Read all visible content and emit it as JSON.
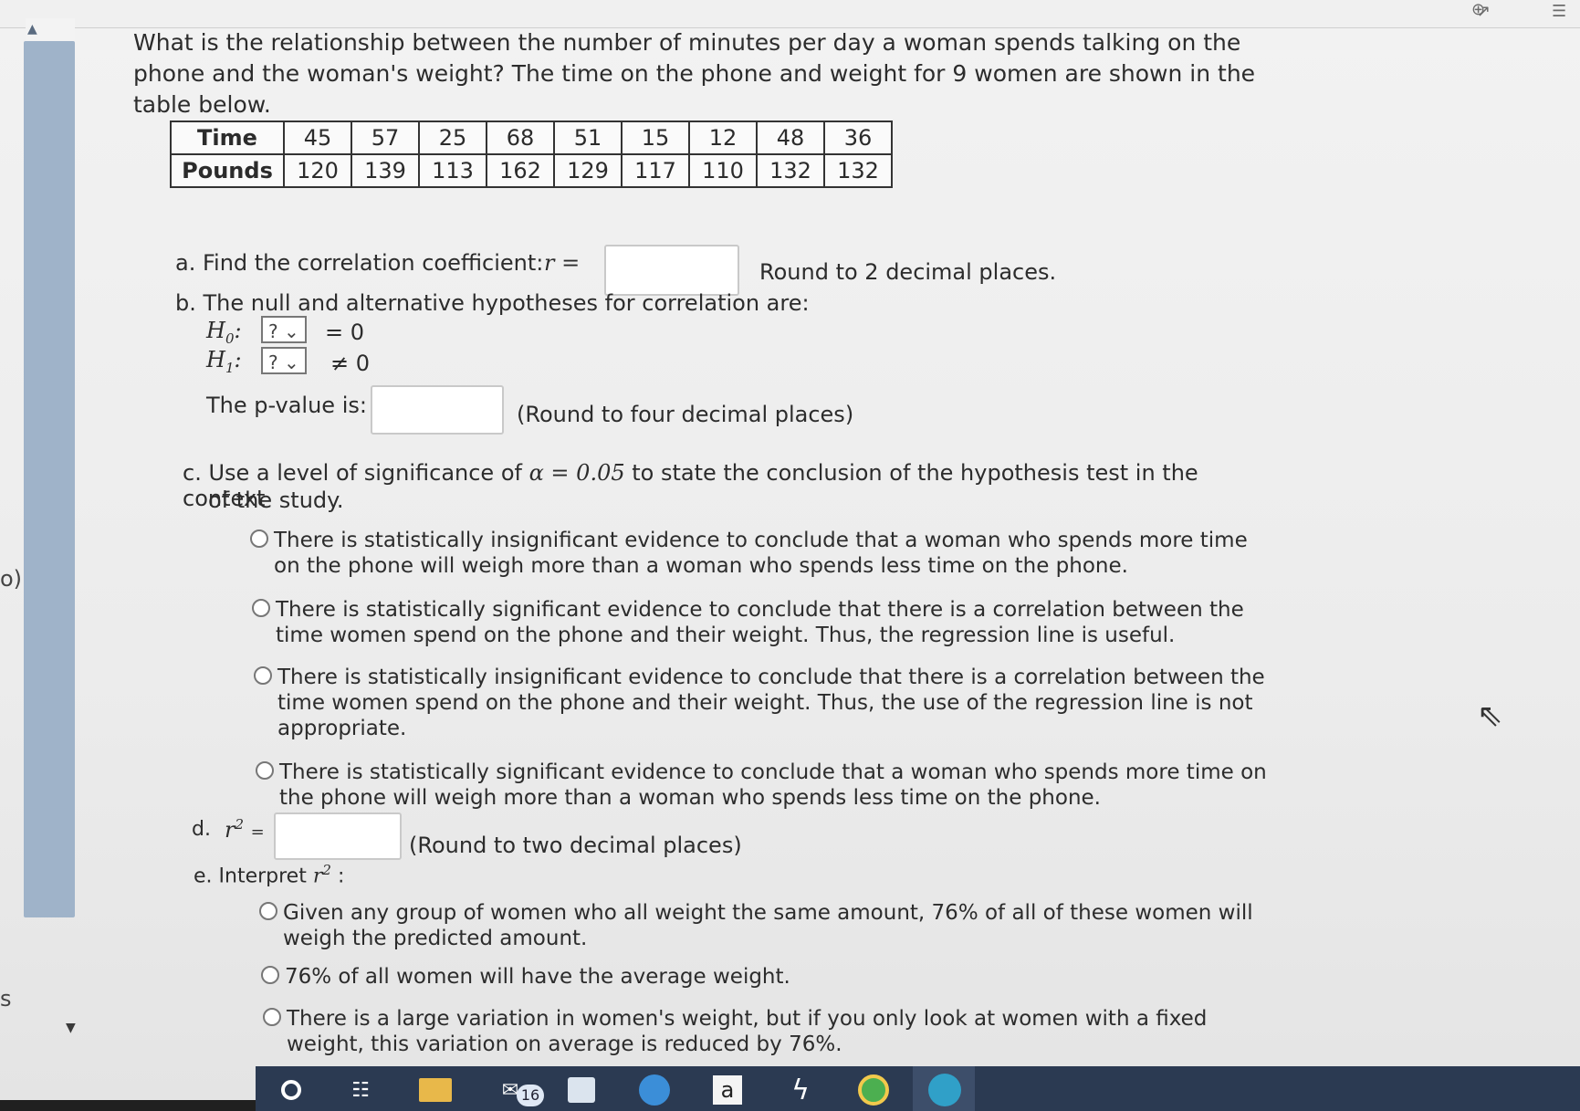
{
  "question": {
    "text": "What is the relationship between the number of minutes per day a woman spends talking on the phone and the woman's weight? The time on the phone and weight for 9 women are shown in the table below."
  },
  "table": {
    "row1_label": "Time",
    "row2_label": "Pounds",
    "time": [
      "45",
      "57",
      "25",
      "68",
      "51",
      "15",
      "12",
      "48",
      "36"
    ],
    "pounds": [
      "120",
      "139",
      "113",
      "162",
      "129",
      "117",
      "110",
      "132",
      "132"
    ]
  },
  "part_a": {
    "label": "a. Find the correlation coefficient:",
    "symbol": "r =",
    "hint": "Round to 2 decimal places.",
    "value": ""
  },
  "part_b": {
    "label": "b. The null and alternative hypotheses for correlation are:",
    "h0": "H",
    "h0_sub": "0",
    "h0_select": "?",
    "h0_rel": "= 0",
    "h1": "H",
    "h1_sub": "1",
    "h1_select": "?",
    "h1_rel": "≠ 0",
    "pvalue_label": "The p-value is:",
    "pvalue_hint": "(Round to four decimal places)",
    "pvalue_value": ""
  },
  "part_c": {
    "label_prefix": "c. Use a level of significance of",
    "alpha_expr": "α = 0.05",
    "label_suffix": "to state the conclusion of the hypothesis test in the context",
    "label_line2": "of the study.",
    "options": [
      {
        "line1": "There is statistically insignificant evidence to conclude that a woman who spends more time",
        "line2": "on the phone will weigh more than a woman who spends less time on the phone.",
        "line3": ""
      },
      {
        "line1": "There is statistically significant evidence to conclude that there is a correlation between the",
        "line2": "time women spend on the phone and their weight. Thus, the regression line is useful.",
        "line3": ""
      },
      {
        "line1": "There is statistically insignificant evidence to conclude that there is a correlation between the",
        "line2": "time women spend on the phone and their weight. Thus, the use of the regression line is not",
        "line3": "appropriate."
      },
      {
        "line1": "There is statistically significant evidence to conclude that a woman who spends more time on",
        "line2": "the phone will weigh more than a woman who spends less time on the phone.",
        "line3": ""
      }
    ]
  },
  "part_d": {
    "label": "d.",
    "symbol": "r",
    "sup": "2",
    "eq": "=",
    "hint": "(Round to two decimal places)",
    "value": ""
  },
  "part_e": {
    "label": "e. Interpret",
    "symbol": "r",
    "sup": "2",
    "colon": ":",
    "options": [
      {
        "line1": "Given any group of women who all weight the same amount, 76% of all of these women will",
        "line2": "weigh the predicted amount."
      },
      {
        "line1": "76% of all women will have the average weight.",
        "line2": ""
      },
      {
        "line1": "There is a large variation in women's weight, but if you only look at women with a fixed",
        "line2": "weight, this variation on average is reduced by 76%."
      }
    ]
  },
  "left_edge": {
    "text1": "o)",
    "text2": "s"
  },
  "taskbar": {
    "mail_badge": "16",
    "amazon_letter": "a",
    "icons": [
      "start-circle-icon",
      "task-view-icon",
      "file-explorer-icon",
      "mail-icon",
      "store-icon",
      "edge-icon",
      "amazon-icon",
      "lightning-icon",
      "chrome-icon",
      "browser-icon"
    ]
  },
  "colors": {
    "scrollbar": "#9fb3c9",
    "taskbar": "#2b3a52"
  }
}
